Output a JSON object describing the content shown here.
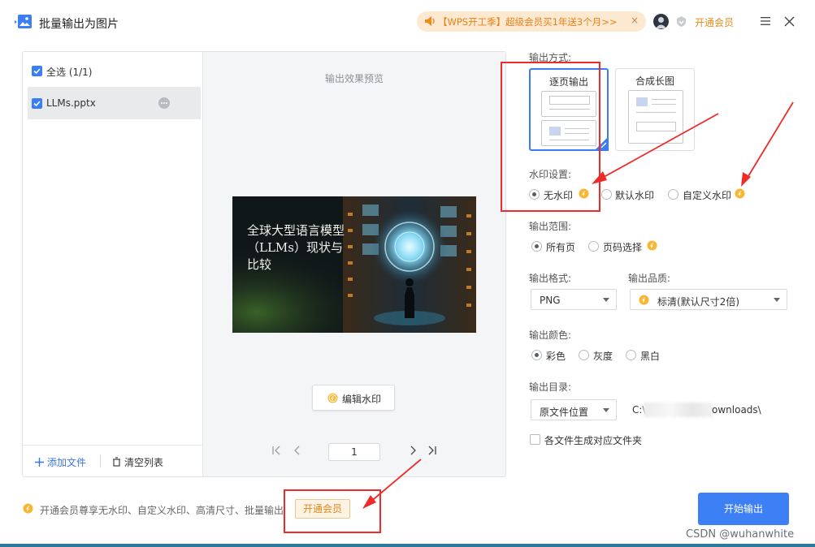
{
  "window": {
    "title": "批量输出为图片"
  },
  "header": {
    "promo_text": "【WPS开工季】超级会员买1年送3个月>>",
    "promo_close": "×",
    "vip_link": "开通会员"
  },
  "file_list": {
    "select_all_label": "全选 (1/1)",
    "select_all_checked": true,
    "files": [
      {
        "name": "LLMs.pptx",
        "checked": true
      }
    ],
    "add_file_label": "添加文件",
    "clear_list_label": "清空列表"
  },
  "preview": {
    "title": "输出效果预览",
    "slide_title": "全球大型语言模型（LLMs）现状与比较",
    "edit_watermark_label": "编辑水印",
    "current_page": "1"
  },
  "settings": {
    "output_mode_label": "输出方式:",
    "output_modes": [
      {
        "label": "逐页输出",
        "selected": true
      },
      {
        "label": "合成长图",
        "selected": false
      }
    ],
    "watermark_label": "水印设置:",
    "watermark_options": [
      {
        "label": "无水印",
        "selected": true,
        "vip": true
      },
      {
        "label": "默认水印",
        "selected": false,
        "vip": false
      },
      {
        "label": "自定义水印",
        "selected": false,
        "vip": true
      }
    ],
    "range_label": "输出范围:",
    "range_options": [
      {
        "label": "所有页",
        "selected": true,
        "vip": false
      },
      {
        "label": "页码选择",
        "selected": false,
        "vip": true
      }
    ],
    "format_label": "输出格式:",
    "format_value": "PNG",
    "quality_label": "输出品质:",
    "quality_value": "标清(默认尺寸2倍)",
    "quality_vip": true,
    "color_label": "输出颜色:",
    "color_options": [
      {
        "label": "彩色",
        "selected": true
      },
      {
        "label": "灰度",
        "selected": false
      },
      {
        "label": "黑白",
        "selected": false
      }
    ],
    "dir_label": "输出目录:",
    "dir_value": "原文件位置",
    "dir_path_start": "C:\\",
    "dir_path_end": "ownloads\\",
    "subfolder_label": "各文件生成对应文件夹",
    "subfolder_checked": false
  },
  "footer": {
    "vip_tip": "开通会员尊享无水印、自定义水印、高清尺寸、批量输出",
    "vip_button": "开通会员",
    "start_button": "开始输出"
  },
  "overlay": {
    "watermark": "CSDN @wuhanwhite"
  },
  "colors": {
    "primary": "#3d7ff5",
    "vip_orange": "#e3851a",
    "annotation_red": "#ee2b28"
  },
  "icons": {
    "app": "image-export-icon",
    "promo": "speaker-icon",
    "vip": "coin-icon",
    "menu": "menu-icon",
    "close": "close-icon"
  }
}
